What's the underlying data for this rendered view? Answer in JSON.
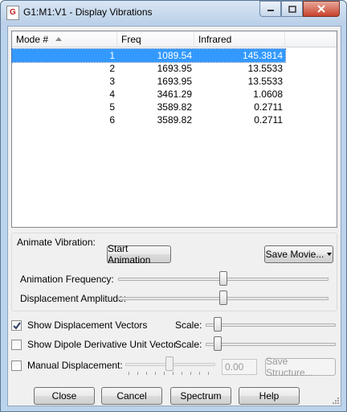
{
  "window": {
    "title": "G1:M1:V1 - Display Vibrations"
  },
  "table": {
    "columns": [
      "Mode #",
      "Freq",
      "Infrared"
    ],
    "rows": [
      {
        "mode": "1",
        "freq": "1089.54",
        "ir": "145.3814",
        "selected": true
      },
      {
        "mode": "2",
        "freq": "1693.95",
        "ir": "13.5533"
      },
      {
        "mode": "3",
        "freq": "1693.95",
        "ir": "13.5533"
      },
      {
        "mode": "4",
        "freq": "3461.29",
        "ir": "1.0608"
      },
      {
        "mode": "5",
        "freq": "3589.82",
        "ir": "0.2711"
      },
      {
        "mode": "6",
        "freq": "3589.82",
        "ir": "0.2711"
      }
    ]
  },
  "animate": {
    "group_label": "Animate Vibration:",
    "start_label": "Start Animation",
    "save_movie_label": "Save Movie...",
    "frequency_label": "Animation Frequency:",
    "amplitude_label": "Displacement Amplitude:",
    "frequency_level": 0.5,
    "amplitude_level": 0.5
  },
  "options": {
    "show_vectors_label": "Show Displacement Vectors",
    "show_vectors_checked": true,
    "show_dipole_label": "Show Dipole Derivative Unit Vector",
    "show_dipole_checked": false,
    "manual_label": "Manual Displacement:",
    "manual_checked": false,
    "scale_label": "Scale:",
    "manual_value": "0.00",
    "save_structure_label": "Save Structure..."
  },
  "buttons": {
    "close": "Close",
    "cancel": "Cancel",
    "spectrum": "Spectrum",
    "help": "Help"
  }
}
